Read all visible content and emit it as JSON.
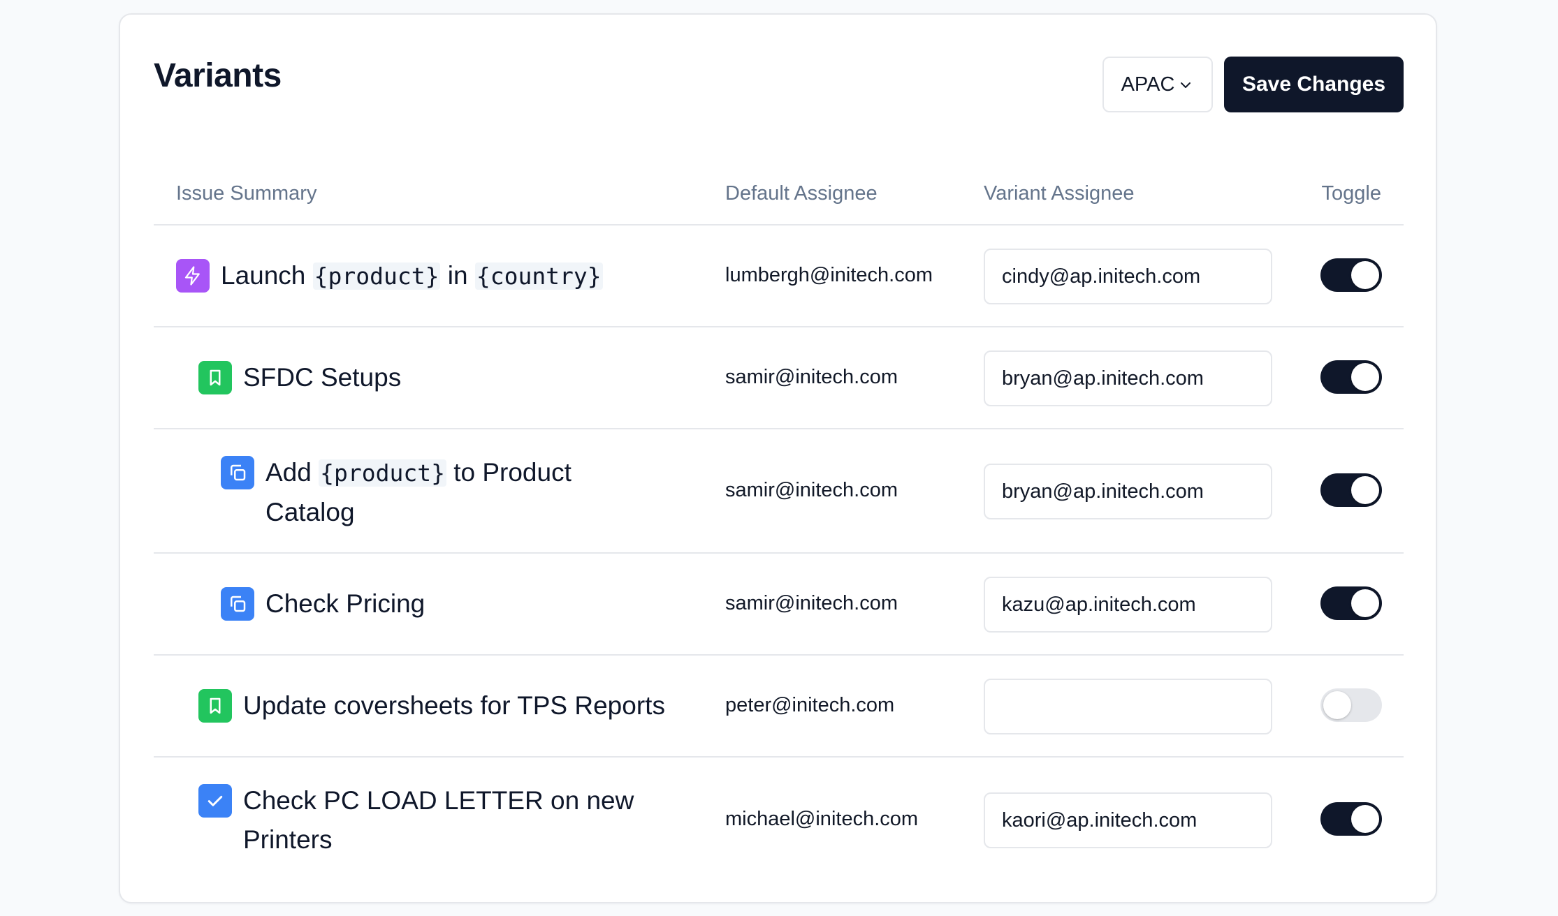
{
  "header": {
    "title": "Variants",
    "region_select": {
      "value": "APAC",
      "icon": "chevron-down-icon"
    },
    "save_label": "Save Changes"
  },
  "table": {
    "columns": {
      "summary": "Issue Summary",
      "default": "Default Assignee",
      "variant": "Variant Assignee",
      "toggle": "Toggle"
    },
    "rows": [
      {
        "icon": "lightning-icon",
        "icon_color": "#a855f7",
        "summary_parts": [
          {
            "t": "Launch ",
            "code": false
          },
          {
            "t": "{product}",
            "code": true
          },
          {
            "t": " in ",
            "code": false
          },
          {
            "t": "{country}",
            "code": true
          }
        ],
        "default_assignee": "lumbergh@initech.com",
        "variant_assignee": "cindy@ap.initech.com",
        "toggle_on": true
      },
      {
        "icon": "bookmark-icon",
        "icon_color": "#22c55e",
        "summary_parts": [
          {
            "t": "SFDC Setups",
            "code": false
          }
        ],
        "default_assignee": "samir@initech.com",
        "variant_assignee": "bryan@ap.initech.com",
        "toggle_on": true
      },
      {
        "icon": "copy-icon",
        "icon_color": "#3b82f6",
        "summary_parts": [
          {
            "t": "Add ",
            "code": false
          },
          {
            "t": "{product}",
            "code": true
          },
          {
            "t": " to Product Catalog",
            "code": false
          }
        ],
        "default_assignee": "samir@initech.com",
        "variant_assignee": "bryan@ap.initech.com",
        "toggle_on": true
      },
      {
        "icon": "copy-icon",
        "icon_color": "#3b82f6",
        "summary_parts": [
          {
            "t": "Check Pricing",
            "code": false
          }
        ],
        "default_assignee": "samir@initech.com",
        "variant_assignee": "kazu@ap.initech.com",
        "toggle_on": true
      },
      {
        "icon": "bookmark-icon",
        "icon_color": "#22c55e",
        "summary_parts": [
          {
            "t": "Update coversheets for TPS Reports",
            "code": false
          }
        ],
        "default_assignee": "peter@initech.com",
        "variant_assignee": "",
        "toggle_on": false
      },
      {
        "icon": "checkbox-icon",
        "icon_color": "#3b82f6",
        "summary_parts": [
          {
            "t": "Check PC LOAD LETTER on new Printers",
            "code": false
          }
        ],
        "default_assignee": "michael@initech.com",
        "variant_assignee": "kaori@ap.initech.com",
        "toggle_on": true
      }
    ]
  }
}
